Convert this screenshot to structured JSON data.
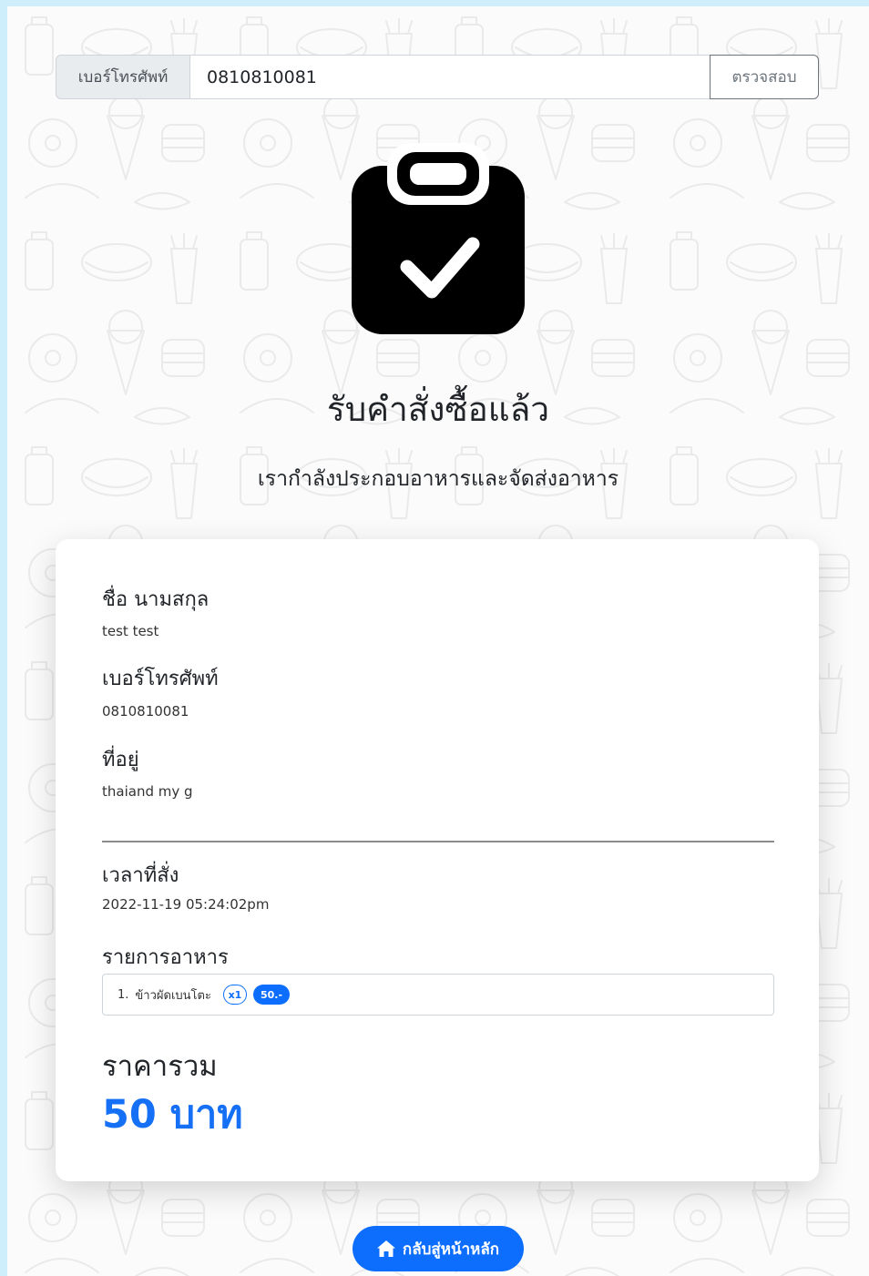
{
  "search": {
    "label": "เบอร์โทรศัพท์",
    "value": "0810810081",
    "button_label": "ตรวจสอบ"
  },
  "hero": {
    "icon": "clipboard-check-icon",
    "title": "รับคำสั่งซื้อแล้ว",
    "subtitle": "เรากำลังประกอบอาหารและจัดส่งอาหาร"
  },
  "order": {
    "name_label": "ชื่อ นามสกุล",
    "name_value": "test test",
    "phone_label": "เบอร์โทรศัพท์",
    "phone_value": "0810810081",
    "address_label": "ที่อยู่",
    "address_value": "thaiand my g",
    "time_label": "เวลาที่สั่ง",
    "time_value": "2022-11-19 05:24:02pm",
    "items_label": "รายการอาหาร",
    "items": [
      {
        "index": "1.",
        "name": "ข้าวผัดเบนโตะ",
        "qty": "x1",
        "price": "50.-"
      }
    ],
    "total_label": "ราคารวม",
    "total_value": "50 บาท"
  },
  "footer": {
    "home_button": "กลับสู่หน้าหลัก",
    "home_icon": "home-icon"
  },
  "colors": {
    "page_border": "#cdeefa",
    "background": "#fbfbfb",
    "primary": "#0d6efd",
    "total_text": "#1670f5",
    "secondary": "#6c757d"
  }
}
